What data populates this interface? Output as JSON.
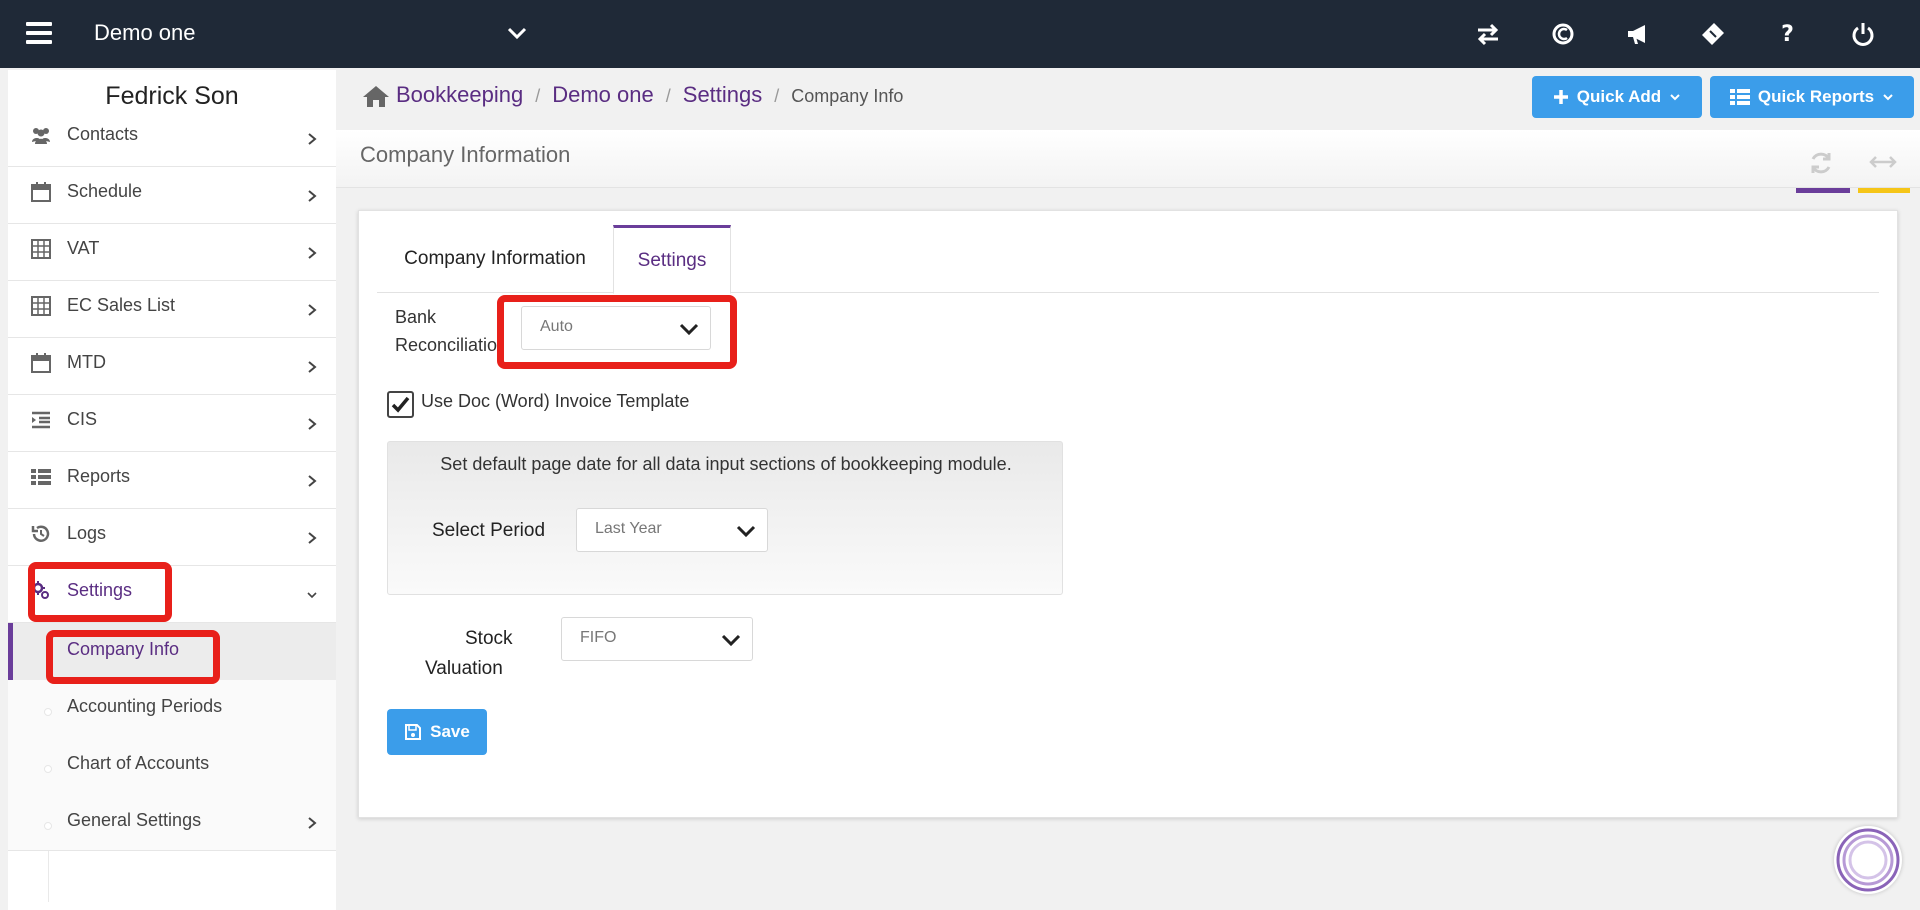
{
  "topbar": {
    "company": "Demo one",
    "icons": [
      "transfer-icon",
      "currency-icon",
      "megaphone-icon",
      "ticket-icon",
      "help-icon",
      "power-icon"
    ],
    "bg_color": "#1f2937"
  },
  "sidebar": {
    "user": "Fedrick Son",
    "items": [
      {
        "label": "Contacts",
        "icon": "users-icon"
      },
      {
        "label": "Schedule",
        "icon": "calendar-icon"
      },
      {
        "label": "VAT",
        "icon": "calculator-icon"
      },
      {
        "label": "EC Sales List",
        "icon": "calculator-icon"
      },
      {
        "label": "MTD",
        "icon": "calendar-icon"
      },
      {
        "label": "CIS",
        "icon": "indent-icon"
      },
      {
        "label": "Reports",
        "icon": "list-icon"
      },
      {
        "label": "Logs",
        "icon": "history-icon"
      },
      {
        "label": "Settings",
        "icon": "cogs-icon"
      }
    ],
    "submenu": [
      {
        "label": "Company Info"
      },
      {
        "label": "Accounting Periods"
      },
      {
        "label": "Chart of Accounts"
      },
      {
        "label": "General Settings"
      }
    ]
  },
  "breadcrumb": {
    "links": [
      "Bookkeeping",
      "Demo one",
      "Settings"
    ],
    "current": "Company Info",
    "separator": "/"
  },
  "header_buttons": {
    "quick_add": "Quick Add",
    "quick_reports": "Quick Reports",
    "color": "#3b9dea"
  },
  "page": {
    "title": "Company Information",
    "tabs": [
      "Company Information",
      "Settings"
    ],
    "active_tab": "Settings"
  },
  "form": {
    "bank_reconciliation_label_1": "Bank",
    "bank_reconciliation_label_2": "Reconciliatio",
    "bank_reconciliation_value": "Auto",
    "use_doc_label": "Use Doc (Word) Invoice Template",
    "use_doc_checked": true,
    "period_help": "Set default page date for all data input sections of bookkeeping module.",
    "select_period_label": "Select Period",
    "select_period_value": "Last Year",
    "stock_valuation_label_1": "Stock",
    "stock_valuation_label_2": "Valuation",
    "stock_valuation_value": "FIFO",
    "save_label": "Save"
  },
  "accent_purple": "#5a2d82",
  "highlight_red": "#e8201a"
}
